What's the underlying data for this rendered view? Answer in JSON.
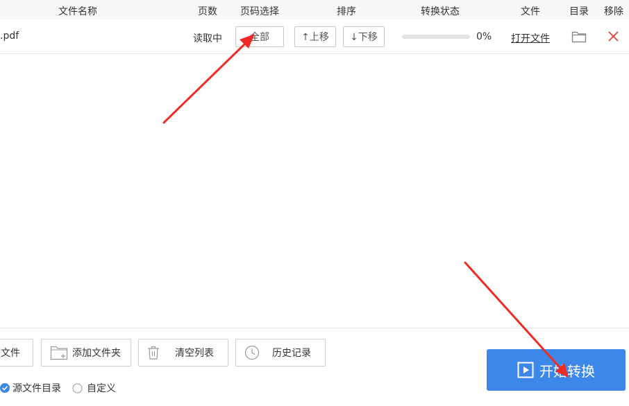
{
  "header": {
    "columns": [
      "文件名称",
      "页数",
      "页码选择",
      "排序",
      "转换状态",
      "文件",
      "目录",
      "移除"
    ]
  },
  "file_row": {
    "name": ".pdf",
    "pages": "读取中",
    "page_select": "全部",
    "move_up": "↑上移",
    "move_down": "↓下移",
    "progress": 0,
    "progress_text": "0%",
    "open_file": "打开文件",
    "folder_icon": "folder-icon",
    "remove_icon": "close-icon"
  },
  "toolbar": {
    "add_file": "文件",
    "add_folder": "添加文件夹",
    "clear_list": "清空列表",
    "history": "历史记录"
  },
  "start_button": {
    "label": "开始转换"
  },
  "output_dir": {
    "source_dir": "源文件目录",
    "custom": "自定义",
    "selected": "源文件目录"
  },
  "colors": {
    "accent": "#3c87e8",
    "remove": "#e0413a",
    "annotation_arrow": "#ee2b24"
  }
}
